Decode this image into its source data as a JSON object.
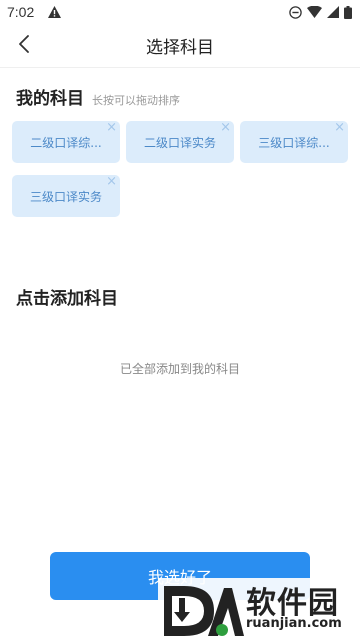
{
  "status_bar": {
    "time": "7:02",
    "warning_icon": "warning-triangle-icon"
  },
  "header": {
    "title": "选择科目",
    "back_icon": "chevron-left-icon"
  },
  "my_subjects": {
    "title": "我的科目",
    "hint": "长按可以拖动排序",
    "items": [
      {
        "label": "二级口译综..."
      },
      {
        "label": "二级口译实务"
      },
      {
        "label": "三级口译综..."
      },
      {
        "label": "三级口译实务"
      }
    ],
    "remove_glyph": "×"
  },
  "add_subjects": {
    "title": "点击添加科目",
    "empty_text": "已全部添加到我的科目"
  },
  "confirm_button": {
    "label": "我选好了"
  },
  "watermark": {
    "text": "软件园",
    "url": "ruanjian.com"
  },
  "colors": {
    "accent": "#2a8ef0",
    "chip_bg": "#dcecfb",
    "chip_text": "#4c89c8"
  }
}
